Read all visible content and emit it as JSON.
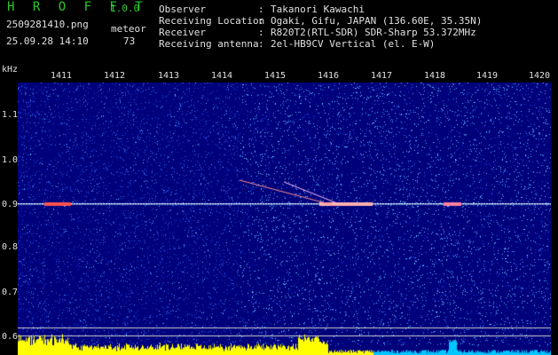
{
  "header": {
    "app_name": "H R O F F T",
    "version": "1.0.0",
    "filename": "2509281410.png",
    "datetime": "25.09.28 14:10",
    "detection_label": "meteor",
    "detection_count": "73"
  },
  "station": [
    {
      "key": "Observer",
      "value": "Takanori Kawachi"
    },
    {
      "key": "Receiving Location",
      "value": "Ogaki, Gifu, JAPAN (136.60E, 35.35N)"
    },
    {
      "key": "Receiver",
      "value": "R820T2(RTL-SDR) SDR-Sharp 53.372MHz"
    },
    {
      "key": "Receiving antenna",
      "value": "2el-HB9CV Vertical (el. E-W)"
    }
  ],
  "spectrogram": {
    "y_unit": "kHz",
    "x_ticks": [
      "1411",
      "1412",
      "1413",
      "1414",
      "1415",
      "1416",
      "1417",
      "1418",
      "1419",
      "1420"
    ],
    "y_ticks": [
      "1.1",
      "1.0",
      "0.9",
      "0.8",
      "0.7",
      "0.6"
    ],
    "y_values": [
      1.1,
      1.0,
      0.9,
      0.8,
      0.7,
      0.6
    ],
    "carrier_khz": 0.9,
    "colors": {
      "background": "#00007a",
      "noise": "#2a5cff",
      "carrier": "#ffffff",
      "level_bar": "#ffff00",
      "level_bar_alt": "#00c8ff"
    }
  }
}
